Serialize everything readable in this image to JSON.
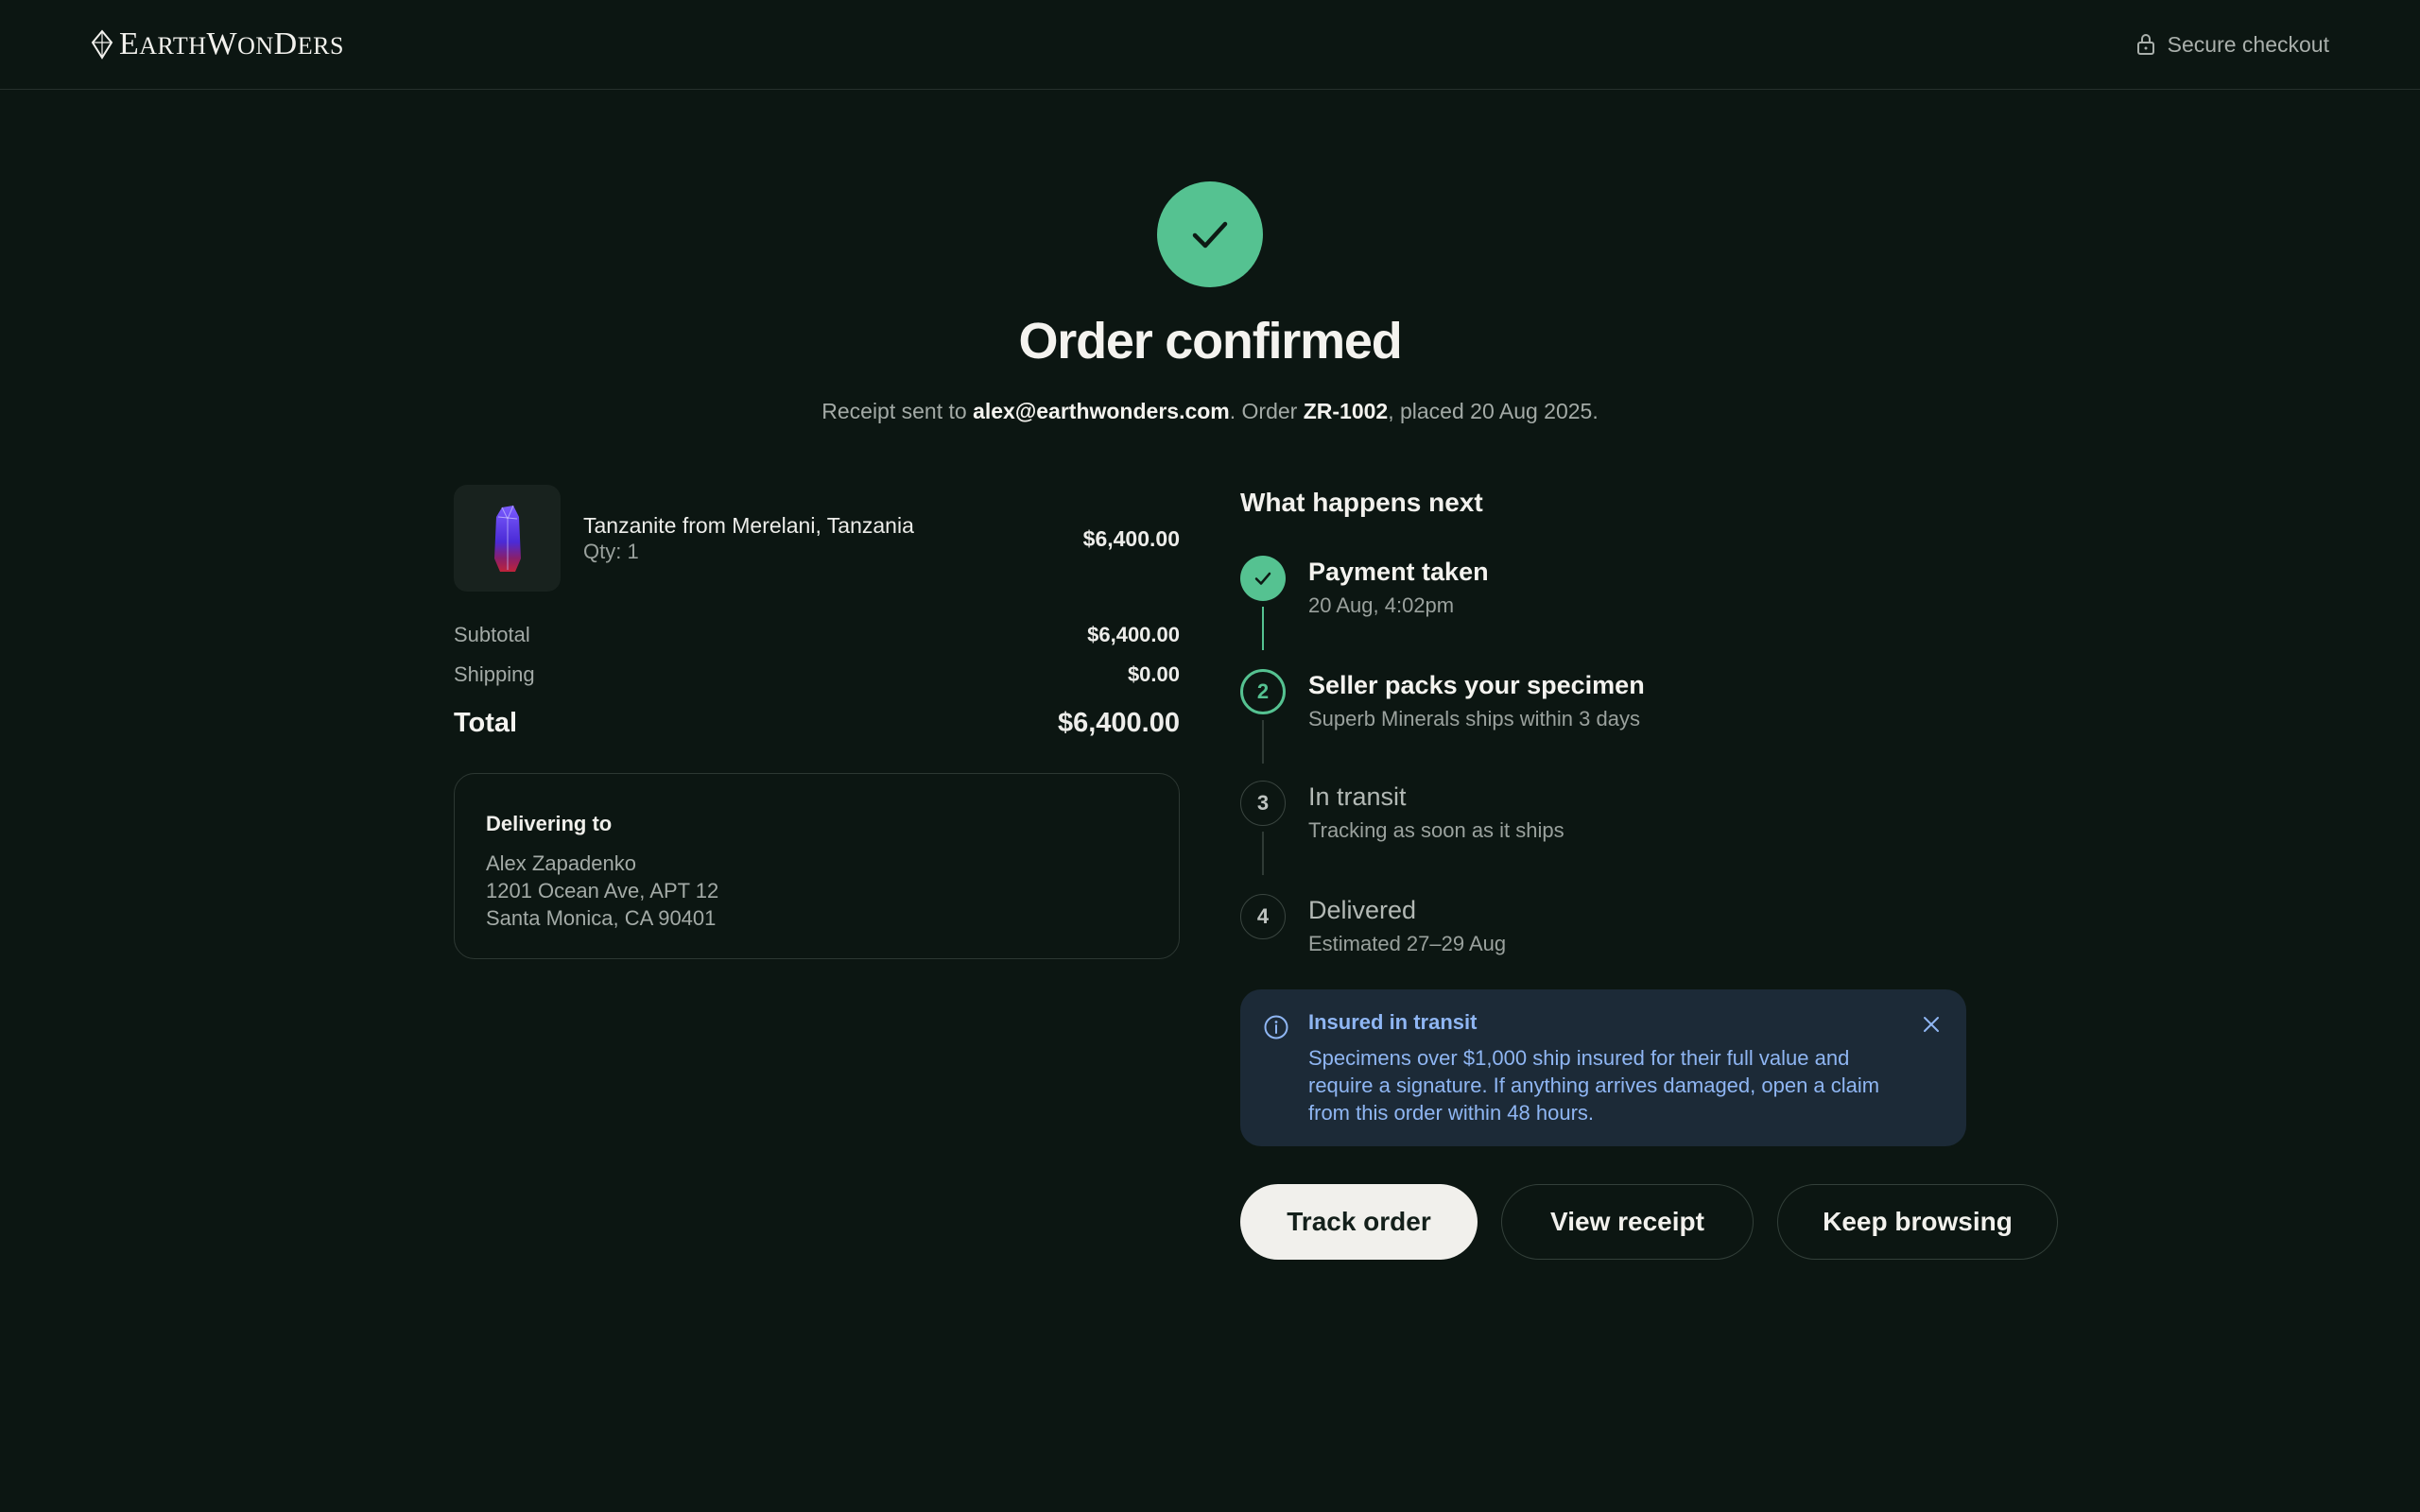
{
  "header": {
    "logo_text_1": "E",
    "logo_text_2": "ARTH",
    "logo_text_3": "W",
    "logo_text_4": "ON",
    "logo_text_5": "D",
    "logo_text_6": "ERS",
    "secure_label": "Secure checkout"
  },
  "hero": {
    "title": "Order confirmed",
    "receipt_prefix": "Receipt sent to ",
    "email": "alex@earthwonders.com",
    "order_prefix": ". Order ",
    "order_id": "ZR-1002",
    "placed_suffix": ", placed 20 Aug 2025."
  },
  "order": {
    "item_name": "Tanzanite from Merelani, Tanzania",
    "item_qty": "Qty: 1",
    "item_price": "$6,400.00",
    "subtotal_label": "Subtotal",
    "subtotal_value": "$6,400.00",
    "shipping_label": "Shipping",
    "shipping_value": "$0.00",
    "total_label": "Total",
    "total_value": "$6,400.00"
  },
  "delivery": {
    "title": "Delivering to",
    "name": "Alex Zapadenko",
    "street": "1201 Ocean Ave, APT 12",
    "city": "Santa Monica, CA 90401"
  },
  "next": {
    "title": "What happens next",
    "steps": [
      {
        "number": "1",
        "title": "Payment taken",
        "sub": "20 Aug, 4:02pm",
        "status": "done"
      },
      {
        "number": "2",
        "title": "Seller packs your specimen",
        "sub": "Superb Minerals ships within 3 days",
        "status": "active"
      },
      {
        "number": "3",
        "title": "In transit",
        "sub": "Tracking as soon as it ships",
        "status": "todo"
      },
      {
        "number": "4",
        "title": "Delivered",
        "sub": "Estimated 27–29 Aug",
        "status": "todo"
      }
    ]
  },
  "notice": {
    "title": "Insured in transit",
    "body": "Specimens over $1,000 ship insured for their full value and require a signature. If anything arrives damaged, open a claim from this order within 48 hours."
  },
  "actions": {
    "track": "Track order",
    "receipt": "View receipt",
    "browse": "Keep browsing"
  },
  "colors": {
    "background": "#0c1612",
    "accent": "#55c291",
    "notice_bg": "#1c2a37",
    "notice_text": "#8fb6f3"
  },
  "icons": [
    "lock-icon",
    "check-icon",
    "info-icon",
    "close-icon",
    "gem-logo-icon"
  ]
}
